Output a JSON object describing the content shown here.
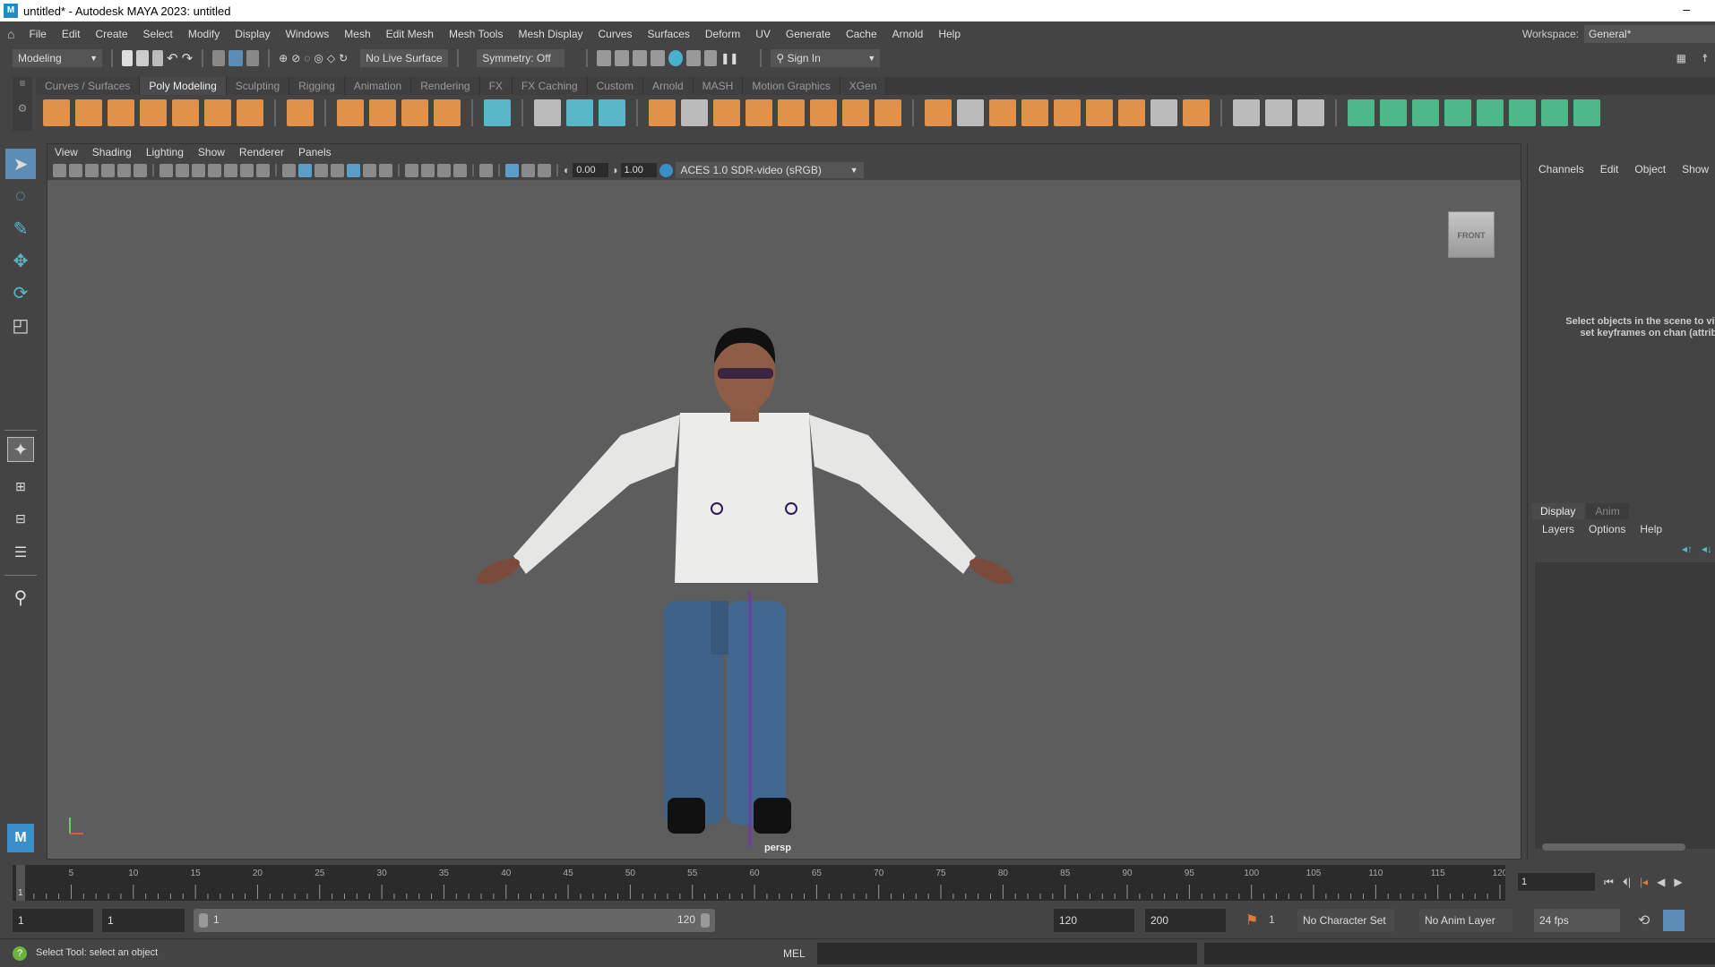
{
  "window": {
    "title": "untitled* - Autodesk MAYA 2023: untitled",
    "minimize": "–"
  },
  "menubar": {
    "items": [
      "File",
      "Edit",
      "Create",
      "Select",
      "Modify",
      "Display",
      "Windows",
      "Mesh",
      "Edit Mesh",
      "Mesh Tools",
      "Mesh Display",
      "Curves",
      "Surfaces",
      "Deform",
      "UV",
      "Generate",
      "Cache",
      "Arnold",
      "Help"
    ],
    "workspace_label": "Workspace:",
    "workspace_value": "General*"
  },
  "statusline": {
    "menuset": "Modeling",
    "live_surface": "No Live Surface",
    "symmetry": "Symmetry: Off",
    "sign_in": "Sign In"
  },
  "shelf": {
    "tabs": [
      "Curves / Surfaces",
      "Poly Modeling",
      "Sculpting",
      "Rigging",
      "Animation",
      "Rendering",
      "FX",
      "FX Caching",
      "Custom",
      "Arnold",
      "MASH",
      "Motion Graphics",
      "XGen"
    ],
    "active_tab": "Poly Modeling",
    "icons": [
      {
        "n": "poly-sphere-icon",
        "c": "#e0914a"
      },
      {
        "n": "poly-cube-icon",
        "c": "#e0914a"
      },
      {
        "n": "poly-cylinder-icon",
        "c": "#e0914a"
      },
      {
        "n": "poly-cone-icon",
        "c": "#e0914a"
      },
      {
        "n": "poly-torus-icon",
        "c": "#e0914a"
      },
      {
        "n": "poly-plane-icon",
        "c": "#e0914a"
      },
      {
        "n": "poly-disc-icon",
        "c": "#e0914a"
      },
      {
        "n": "|"
      },
      {
        "n": "platonic-solid-icon",
        "c": "#e0914a"
      },
      {
        "n": "|"
      },
      {
        "n": "sweep-mesh-icon",
        "c": "#e0914a"
      },
      {
        "n": "poly-helix-icon",
        "c": "#e0914a"
      },
      {
        "n": "type-text-icon",
        "c": "#e0914a"
      },
      {
        "n": "svg-icon",
        "c": "#e0914a"
      },
      {
        "n": "|"
      },
      {
        "n": "grid-editor-icon",
        "c": "#5ab7c7"
      },
      {
        "n": "|"
      },
      {
        "n": "center-pivot-icon",
        "c": "#bbbbbb"
      },
      {
        "n": "delete-history-icon",
        "c": "#5ab7c7"
      },
      {
        "n": "freeze-transform-icon",
        "c": "#5ab7c7"
      },
      {
        "n": "|"
      },
      {
        "n": "combine-icon",
        "c": "#e0914a"
      },
      {
        "n": "separate-icon",
        "c": "#bbbbbb"
      },
      {
        "n": "mirror-icon",
        "c": "#e0914a"
      },
      {
        "n": "smooth-icon",
        "c": "#e0914a"
      },
      {
        "n": "reduce-icon",
        "c": "#e0914a"
      },
      {
        "n": "boolean-icon",
        "c": "#e0914a"
      },
      {
        "n": "remesh-icon",
        "c": "#e0914a"
      },
      {
        "n": "retopologize-icon",
        "c": "#e0914a"
      },
      {
        "n": "|"
      },
      {
        "n": "extrude-icon",
        "c": "#e0914a"
      },
      {
        "n": "bridge-icon",
        "c": "#bbbbbb"
      },
      {
        "n": "bevel-icon",
        "c": "#e0914a"
      },
      {
        "n": "append-polygon-icon",
        "c": "#e0914a"
      },
      {
        "n": "fill-hole-icon",
        "c": "#e0914a"
      },
      {
        "n": "make-hole-icon",
        "c": "#e0914a"
      },
      {
        "n": "wedge-icon",
        "c": "#e0914a"
      },
      {
        "n": "poke-icon",
        "c": "#bbbbbb"
      },
      {
        "n": "circularize-icon",
        "c": "#e0914a"
      },
      {
        "n": "|"
      },
      {
        "n": "multi-cut-icon",
        "c": "#bbbbbb"
      },
      {
        "n": "insert-edge-loop-icon",
        "c": "#bbbbbb"
      },
      {
        "n": "offset-edge-loop-icon",
        "c": "#bbbbbb"
      },
      {
        "n": "|"
      },
      {
        "n": "planar-uv-icon",
        "c": "#4fb88a"
      },
      {
        "n": "cylindrical-uv-icon",
        "c": "#4fb88a"
      },
      {
        "n": "spherical-uv-icon",
        "c": "#4fb88a"
      },
      {
        "n": "automatic-uv-icon",
        "c": "#4fb88a"
      },
      {
        "n": "unfold-uv-icon",
        "c": "#4fb88a"
      },
      {
        "n": "uv-editor-icon",
        "c": "#4fb88a"
      },
      {
        "n": "cut-uv-icon",
        "c": "#4fb88a"
      },
      {
        "n": "sew-uv-icon",
        "c": "#4fb88a"
      }
    ]
  },
  "viewport": {
    "menus": [
      "View",
      "Shading",
      "Lighting",
      "Show",
      "Renderer",
      "Panels"
    ],
    "exposure": "0.00",
    "gamma": "1.00",
    "color_space": "ACES 1.0 SDR-video (sRGB)",
    "viewcube": "FRONT",
    "camera": "persp"
  },
  "channelbox": {
    "menus": [
      "Channels",
      "Edit",
      "Object",
      "Show"
    ],
    "message": "Select objects in the scene to vi edit and set keyframes on chan (attributes)"
  },
  "layers": {
    "tabs": [
      "Display",
      "Anim"
    ],
    "menus": [
      "Layers",
      "Options",
      "Help"
    ]
  },
  "timeline": {
    "start": 1,
    "end": 120,
    "ticks": [
      5,
      10,
      15,
      20,
      25,
      30,
      35,
      40,
      45,
      50,
      55,
      60,
      65,
      70,
      75,
      80,
      85,
      90,
      95,
      100,
      105,
      110,
      115,
      120
    ],
    "current_frame_label": "1",
    "current_frame": "1"
  },
  "range": {
    "start": "1",
    "playback_start": "1",
    "slider_start": "1",
    "slider_end": "120",
    "playback_end": "120",
    "end": "200",
    "key_count": "1",
    "character_set": "No Character Set",
    "anim_layer": "No Anim Layer",
    "fps": "24 fps"
  },
  "commandline": {
    "help": "Select Tool: select an object",
    "lang": "MEL"
  }
}
